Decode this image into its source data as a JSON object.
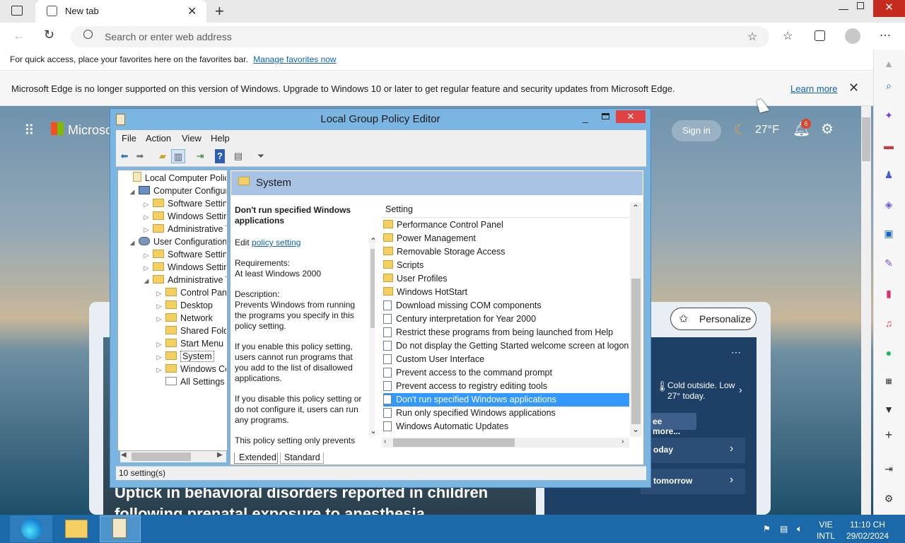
{
  "browser": {
    "tab_title": "New tab",
    "address_placeholder": "Search or enter web address",
    "favorites_text": "For quick access, place your favorites here on the favorites bar.",
    "favorites_link": "Manage favorites now",
    "info_text": "Microsoft Edge is no longer supported on this version of Windows. Upgrade to Windows 10 or later to get regular feature and security updates from Microsoft Edge.",
    "info_link": "Learn more"
  },
  "msn": {
    "brand": "Microso",
    "signin": "Sign in",
    "temperature": "27°F",
    "notif_count": "6",
    "personalize": "Personalize",
    "weather_text": "Cold outside. Low 27° today.",
    "see_more": "ee more...",
    "today": "oday",
    "tomorrow": "tomorrow",
    "headline": "Uptick in behavioral disorders reported in children following prenatal exposure to anesthesia"
  },
  "gpedit": {
    "title": "Local Group Policy Editor",
    "menu": [
      "File",
      "Action",
      "View",
      "Help"
    ],
    "tree": [
      {
        "label": "Local Computer Policy"
      },
      {
        "label": "Computer Configura"
      },
      {
        "label": "Software Settings"
      },
      {
        "label": "Windows Setting"
      },
      {
        "label": "Administrative Te"
      },
      {
        "label": "User Configuration"
      },
      {
        "label": "Software Settings"
      },
      {
        "label": "Windows Setting"
      },
      {
        "label": "Administrative Te"
      },
      {
        "label": "Control Panel"
      },
      {
        "label": "Desktop"
      },
      {
        "label": "Network"
      },
      {
        "label": "Shared Folder"
      },
      {
        "label": "Start Menu ar"
      },
      {
        "label": "System"
      },
      {
        "label": "Windows Cor"
      },
      {
        "label": "All Settings"
      }
    ],
    "section_title": "System",
    "policy_title": "Don't run specified Windows applications",
    "edit_label": "Edit",
    "edit_link": "policy setting",
    "requirements_label": "Requirements:",
    "requirements_value": "At least Windows 2000",
    "description_label": "Description:",
    "desc1": "Prevents Windows from running the programs you specify in this policy setting.",
    "desc2": "If you enable this policy setting, users cannot run programs that you add to the list of disallowed applications.",
    "desc3": "If you disable this policy setting or do not configure it, users can run any programs.",
    "desc4": "This policy setting only prevents",
    "column_setting": "Setting",
    "settings": [
      {
        "label": "Performance Control Panel",
        "type": "folder"
      },
      {
        "label": "Power Management",
        "type": "folder"
      },
      {
        "label": "Removable Storage Access",
        "type": "folder"
      },
      {
        "label": "Scripts",
        "type": "folder"
      },
      {
        "label": "User Profiles",
        "type": "folder"
      },
      {
        "label": "Windows HotStart",
        "type": "folder"
      },
      {
        "label": "Download missing COM components",
        "type": "policy"
      },
      {
        "label": "Century interpretation for Year 2000",
        "type": "policy"
      },
      {
        "label": "Restrict these programs from being launched from Help",
        "type": "policy"
      },
      {
        "label": "Do not display the Getting Started welcome screen at logon",
        "type": "policy"
      },
      {
        "label": "Custom User Interface",
        "type": "policy"
      },
      {
        "label": "Prevent access to the command prompt",
        "type": "policy"
      },
      {
        "label": "Prevent access to registry editing tools",
        "type": "policy"
      },
      {
        "label": "Don't run specified Windows applications",
        "type": "policy",
        "selected": true
      },
      {
        "label": "Run only specified Windows applications",
        "type": "policy"
      },
      {
        "label": "Windows Automatic Updates",
        "type": "policy"
      }
    ],
    "tab_extended": "Extended",
    "tab_standard": "Standard",
    "status": "10 setting(s)"
  },
  "taskbar": {
    "lang_top": "VIE",
    "lang_bottom": "INTL",
    "time": "11:10 CH",
    "date": "29/02/2024"
  },
  "colors": {
    "accent": "#3399ff",
    "taskbar": "#1b69a8",
    "window_frame": "#7bb6e3",
    "close": "#e04343"
  }
}
